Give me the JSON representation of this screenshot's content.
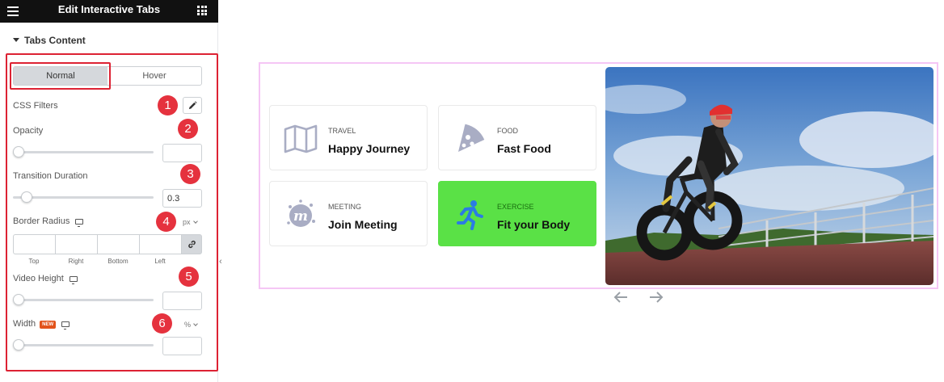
{
  "panel": {
    "title": "Edit Interactive Tabs",
    "section": "Tabs Content",
    "tabs": [
      {
        "label": "Normal",
        "active": true
      },
      {
        "label": "Hover",
        "active": false
      }
    ],
    "css_filters_label": "CSS Filters",
    "opacity_label": "Opacity",
    "opacity_value": "",
    "transition_label": "Transition Duration",
    "transition_value": "0.3",
    "border_radius_label": "Border Radius",
    "border_radius_unit": "px",
    "border_radius_sides": [
      "Top",
      "Right",
      "Bottom",
      "Left"
    ],
    "video_height_label": "Video Height",
    "video_height_value": "",
    "width_label": "Width",
    "width_badge": "NEW",
    "width_unit": "%",
    "width_value": "",
    "sliders": {
      "opacity": 0,
      "transition": 0.1,
      "video_height": 0,
      "width": 0
    },
    "markers": [
      "1",
      "2",
      "3",
      "4",
      "5",
      "6"
    ]
  },
  "preview": {
    "cards": [
      {
        "category": "TRAVEL",
        "title": "Happy Journey",
        "icon": "map-icon",
        "active": false
      },
      {
        "category": "FOOD",
        "title": "Fast Food",
        "icon": "pizza-icon",
        "active": false
      },
      {
        "category": "MEETING",
        "title": "Join Meeting",
        "icon": "meetup-icon",
        "active": false
      },
      {
        "category": "EXERCISE",
        "title": "Fit your Body",
        "icon": "running-icon",
        "active": true
      }
    ],
    "image": "cyclist-photo",
    "colors": {
      "active_card": "#5ae146",
      "icon_gray": "#a9adc4",
      "badge_red": "#e5323e",
      "outline_pink": "#f5c6f5"
    }
  }
}
